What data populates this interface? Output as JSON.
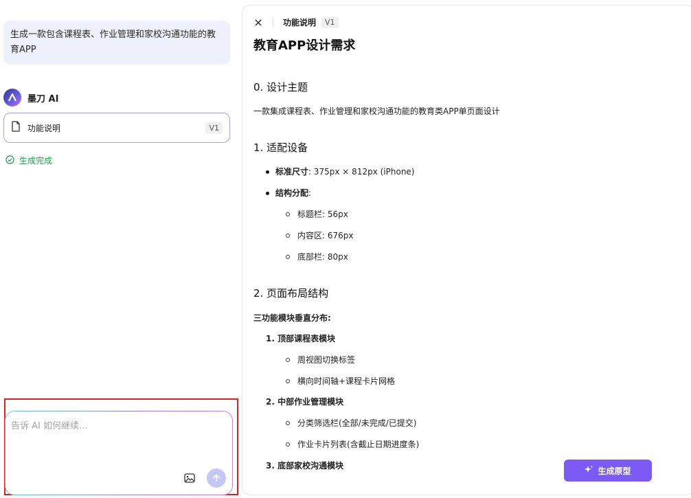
{
  "chat": {
    "user_message": "生成一款包含课程表、作业管理和家校沟通功能的教育APP",
    "ai_name": "墨刀 AI",
    "doc_card_label": "功能说明",
    "doc_card_version": "V1",
    "status_text": "生成完成",
    "input_placeholder": "告诉 AI 如何继续…"
  },
  "panel": {
    "title": "功能说明",
    "version": "V1",
    "generate_button": "生成原型"
  },
  "document": {
    "title": "教育APP设计需求",
    "s0_heading": "0. 设计主题",
    "s0_text": "一款集成课程表、作业管理和家校沟通功能的教育类APP单页面设计",
    "s1_heading": "1. 适配设备",
    "s1_b1_label": "标准尺寸",
    "s1_b1_value": ": 375px × 812px (iPhone)",
    "s1_b2_label": "结构分配",
    "s1_b2_suffix": ":",
    "s1_sub1": "标题栏: 56px",
    "s1_sub2": "内容区: 676px",
    "s1_sub3": "底部栏: 80px",
    "s2_heading": "2. 页面布局结构",
    "s2_intro": "三功能模块垂直分布:",
    "s2_item1": "1. 顶部课程表模块",
    "s2_item1_sub1": "周视图切换标签",
    "s2_item1_sub2": "横向时间轴+课程卡片网格",
    "s2_item2": "2. 中部作业管理模块",
    "s2_item2_sub1": "分类筛选栏(全部/未完成/已提交)",
    "s2_item2_sub2": "作业卡片列表(含截止日期进度条)",
    "s2_item3": "3. 底部家校沟通模块"
  },
  "colors": {
    "accent": "#7b5af5",
    "success": "#15a34a",
    "highlight_border": "#e02020"
  }
}
